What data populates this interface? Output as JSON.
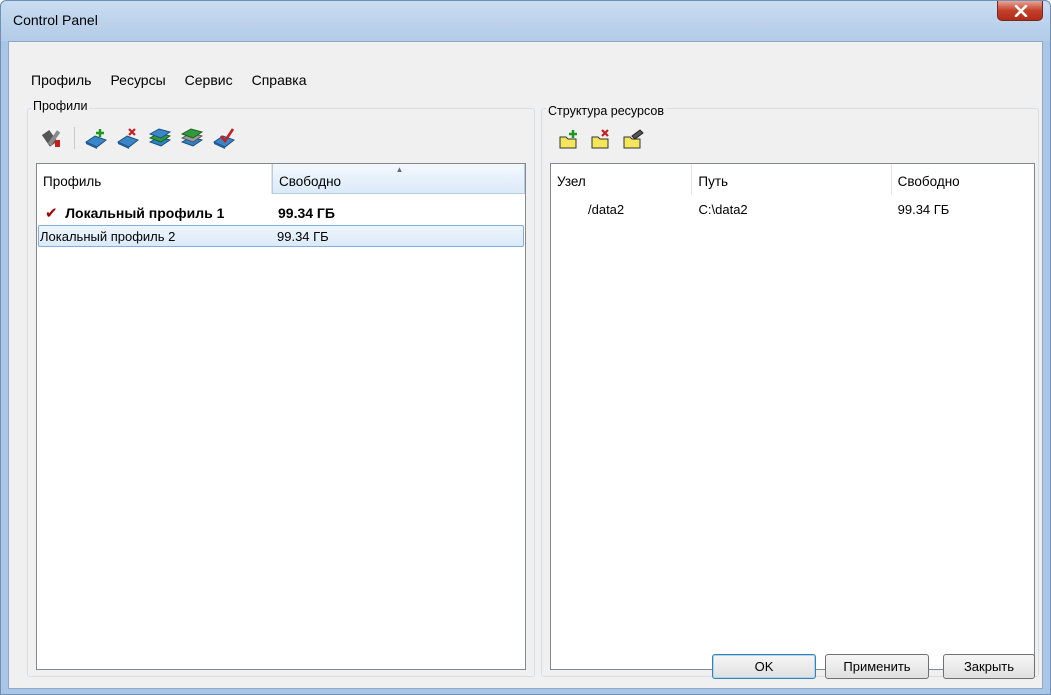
{
  "window": {
    "title": "Control Panel"
  },
  "menu": [
    "Профиль",
    "Ресурсы",
    "Сервис",
    "Справка"
  ],
  "profiles": {
    "label": "Профили",
    "columns": [
      "Профиль",
      "Свободно"
    ],
    "rows": [
      {
        "name": "Локальный профиль 1",
        "free": "99.34 ГБ",
        "active": true
      },
      {
        "name": "Локальный профиль 2",
        "free": "99.34 ГБ",
        "active": false
      }
    ]
  },
  "resources": {
    "label": "Структура ресурсов",
    "columns": [
      "Узел",
      "Путь",
      "Свободно"
    ],
    "rows": [
      {
        "node": "/data2",
        "path": "C:\\data2",
        "free": "99.34 ГБ"
      }
    ]
  },
  "buttons": {
    "ok": "OK",
    "apply": "Применить",
    "close": "Закрыть"
  },
  "colors": {
    "title_bar": "#b9cfea",
    "close": "#c4402b",
    "selection": "#dbeaf9",
    "check": "#a00000"
  }
}
